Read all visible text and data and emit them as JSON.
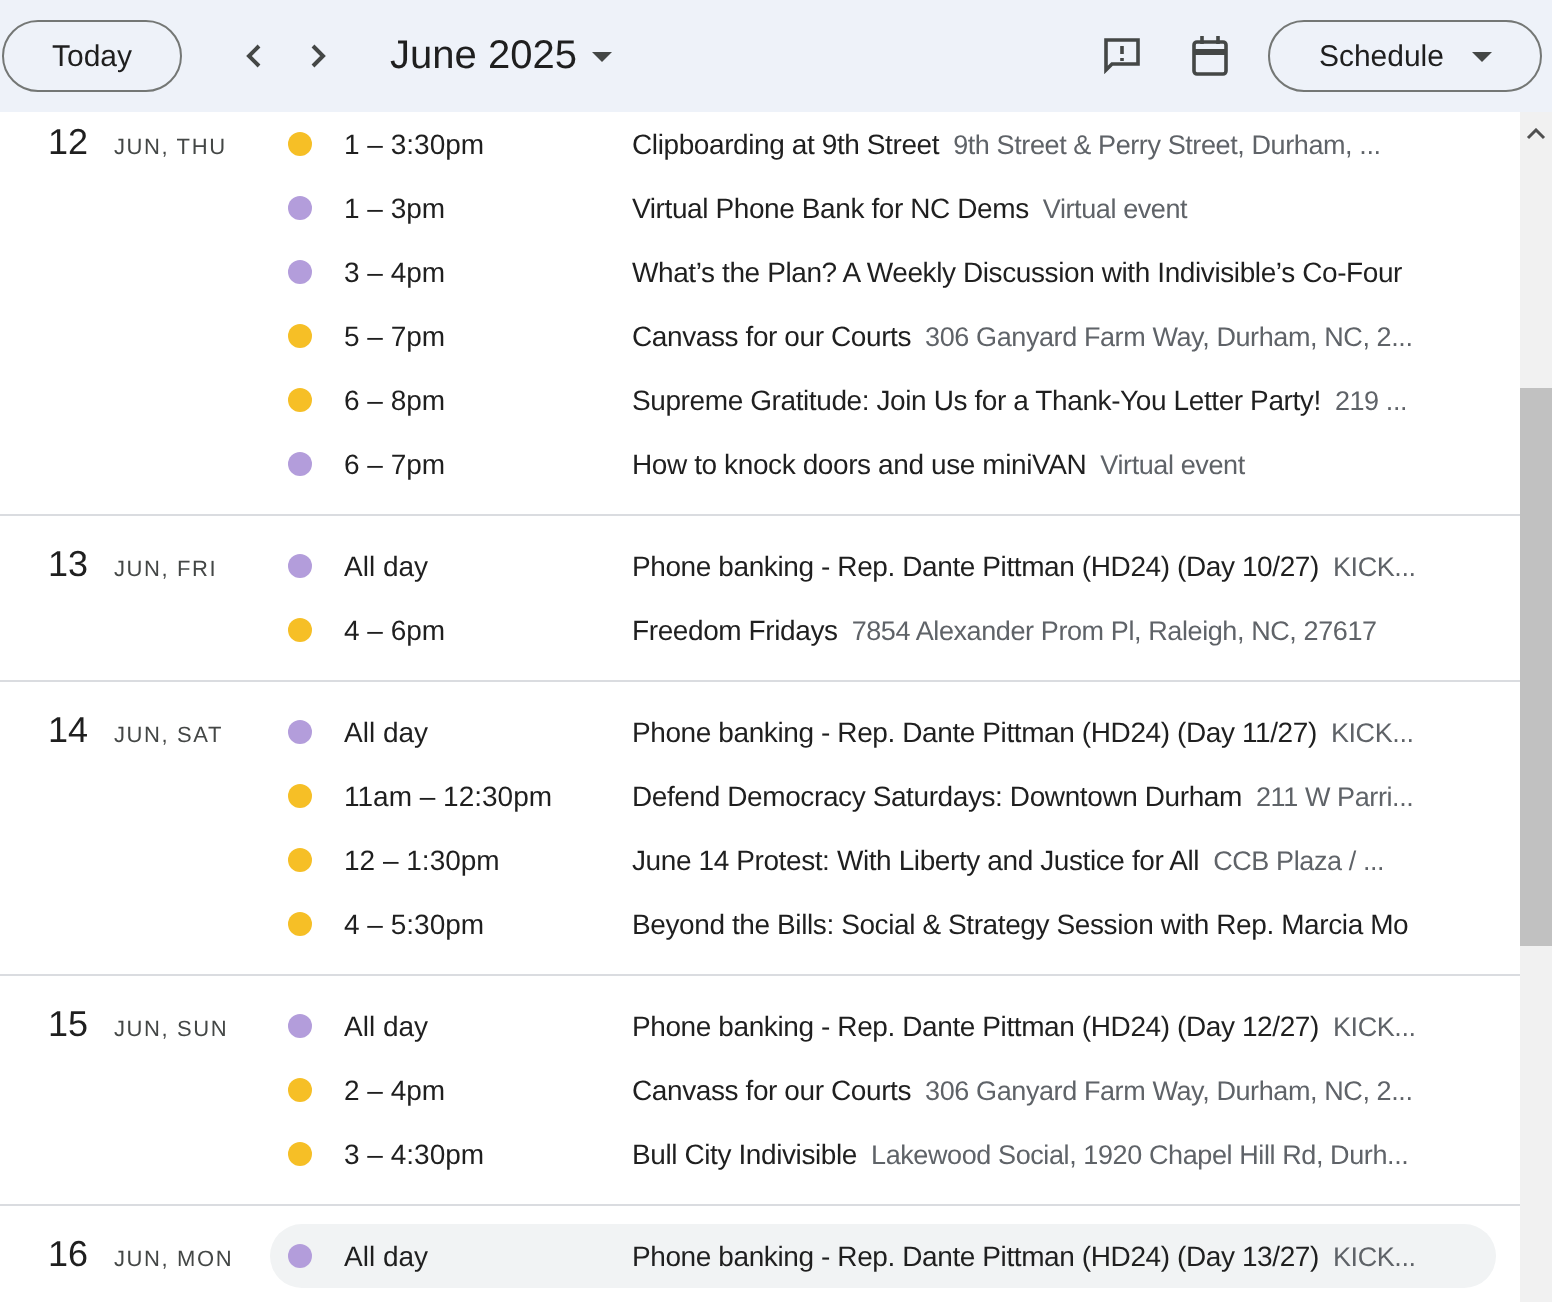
{
  "toolbar": {
    "today": "Today",
    "month": "June 2025",
    "view": "Schedule"
  },
  "days": [
    {
      "day": "12",
      "label": "JUN, THU",
      "events": [
        {
          "color": "#f6bf26",
          "time": "1 – 3:30pm",
          "title": "Clipboarding at 9th Street",
          "location": "9th Street & Perry Street, Durham, ...",
          "highlighted": false
        },
        {
          "color": "#b39ddb",
          "time": "1 – 3pm",
          "title": "Virtual Phone Bank for NC Dems",
          "location": "Virtual event",
          "highlighted": false
        },
        {
          "color": "#b39ddb",
          "time": "3 – 4pm",
          "title": "What’s the Plan? A Weekly Discussion with Indivisible’s Co-Four",
          "highlighted": false
        },
        {
          "color": "#f6bf26",
          "time": "5 – 7pm",
          "title": "Canvass for our Courts",
          "location": "306 Ganyard Farm Way, Durham, NC, 2...",
          "highlighted": false
        },
        {
          "color": "#f6bf26",
          "time": "6 – 8pm",
          "title": "Supreme Gratitude: Join Us for a Thank-You Letter Party!",
          "location": "219 ...",
          "highlighted": false
        },
        {
          "color": "#b39ddb",
          "time": "6 – 7pm",
          "title": "How to knock doors and use miniVAN",
          "location": "Virtual event",
          "highlighted": false
        }
      ]
    },
    {
      "day": "13",
      "label": "JUN, FRI",
      "events": [
        {
          "color": "#b39ddb",
          "time": "All day",
          "title": "Phone banking - Rep. Dante Pittman (HD24) (Day 10/27)",
          "location": "KICK...",
          "highlighted": false
        },
        {
          "color": "#f6bf26",
          "time": "4 – 6pm",
          "title": "Freedom Fridays",
          "location": "7854 Alexander Prom Pl, Raleigh, NC, 27617",
          "highlighted": false
        }
      ]
    },
    {
      "day": "14",
      "label": "JUN, SAT",
      "events": [
        {
          "color": "#b39ddb",
          "time": "All day",
          "title": "Phone banking - Rep. Dante Pittman (HD24) (Day 11/27)",
          "location": "KICK...",
          "highlighted": false
        },
        {
          "color": "#f6bf26",
          "time": "11am – 12:30pm",
          "title": "Defend Democracy Saturdays: Downtown Durham",
          "location": "211 W Parri...",
          "highlighted": false
        },
        {
          "color": "#f6bf26",
          "time": "12 – 1:30pm",
          "title": "June 14 Protest: With Liberty and Justice for All",
          "location": "CCB Plaza / ...",
          "highlighted": false
        },
        {
          "color": "#f6bf26",
          "time": "4 – 5:30pm",
          "title": "Beyond the Bills: Social & Strategy Session with Rep. Marcia Mo",
          "highlighted": false
        }
      ]
    },
    {
      "day": "15",
      "label": "JUN, SUN",
      "events": [
        {
          "color": "#b39ddb",
          "time": "All day",
          "title": "Phone banking - Rep. Dante Pittman (HD24) (Day 12/27)",
          "location": "KICK...",
          "highlighted": false
        },
        {
          "color": "#f6bf26",
          "time": "2 – 4pm",
          "title": "Canvass for our Courts",
          "location": "306 Ganyard Farm Way, Durham, NC, 2...",
          "highlighted": false
        },
        {
          "color": "#f6bf26",
          "time": "3 – 4:30pm",
          "title": "Bull City Indivisible",
          "location": "Lakewood Social, 1920 Chapel Hill Rd, Durh...",
          "highlighted": false
        }
      ]
    },
    {
      "day": "16",
      "label": "JUN, MON",
      "events": [
        {
          "color": "#b39ddb",
          "time": "All day",
          "title": "Phone banking - Rep. Dante Pittman (HD24) (Day 13/27)",
          "location": "KICK...",
          "highlighted": true
        }
      ]
    }
  ]
}
